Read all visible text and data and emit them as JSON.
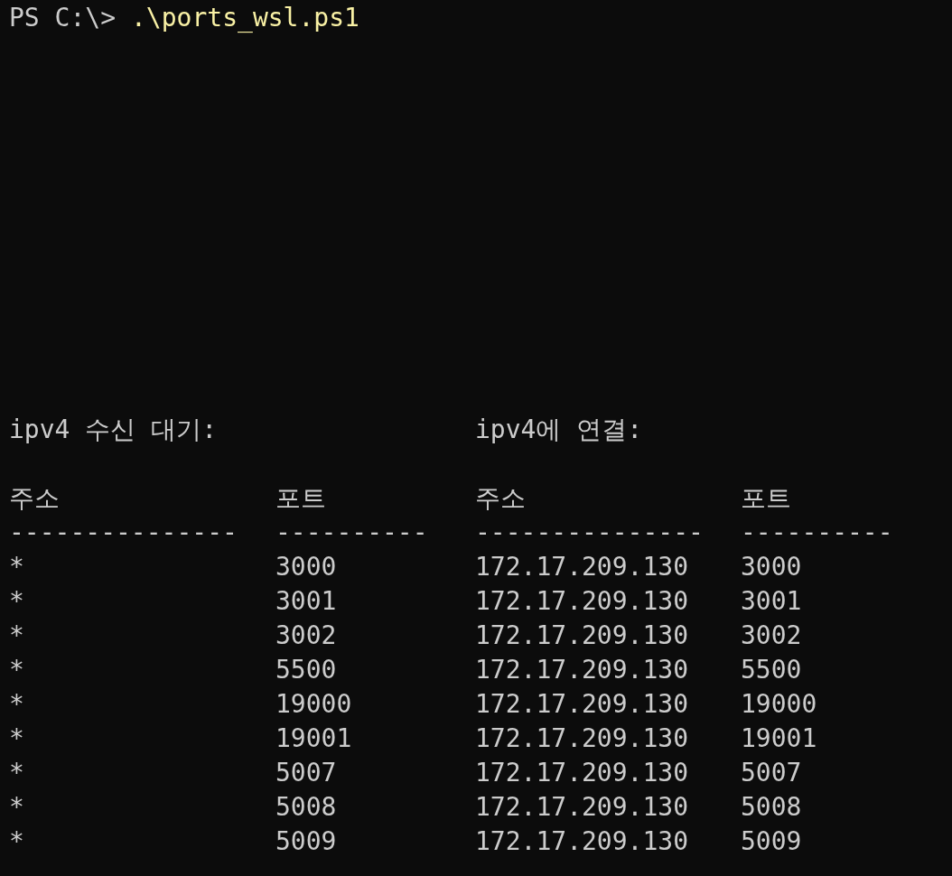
{
  "terminal": {
    "prompt": "PS C:\\>",
    "command": ".\\ports_wsl.ps1",
    "section_titles": [
      "ipv4 수신 대기:",
      "ipv4에 연결:"
    ],
    "columns": [
      "주소",
      "포트",
      "주소",
      "포트"
    ],
    "separators": [
      "---------------",
      "----------",
      "---------------",
      "----------"
    ],
    "rows": [
      [
        "*",
        "3000",
        "172.17.209.130",
        "3000"
      ],
      [
        "*",
        "3001",
        "172.17.209.130",
        "3001"
      ],
      [
        "*",
        "3002",
        "172.17.209.130",
        "3002"
      ],
      [
        "*",
        "5500",
        "172.17.209.130",
        "5500"
      ],
      [
        "*",
        "19000",
        "172.17.209.130",
        "19000"
      ],
      [
        "*",
        "19001",
        "172.17.209.130",
        "19001"
      ],
      [
        "*",
        "5007",
        "172.17.209.130",
        "5007"
      ],
      [
        "*",
        "5008",
        "172.17.209.130",
        "5008"
      ],
      [
        "*",
        "5009",
        "172.17.209.130",
        "5009"
      ]
    ]
  }
}
